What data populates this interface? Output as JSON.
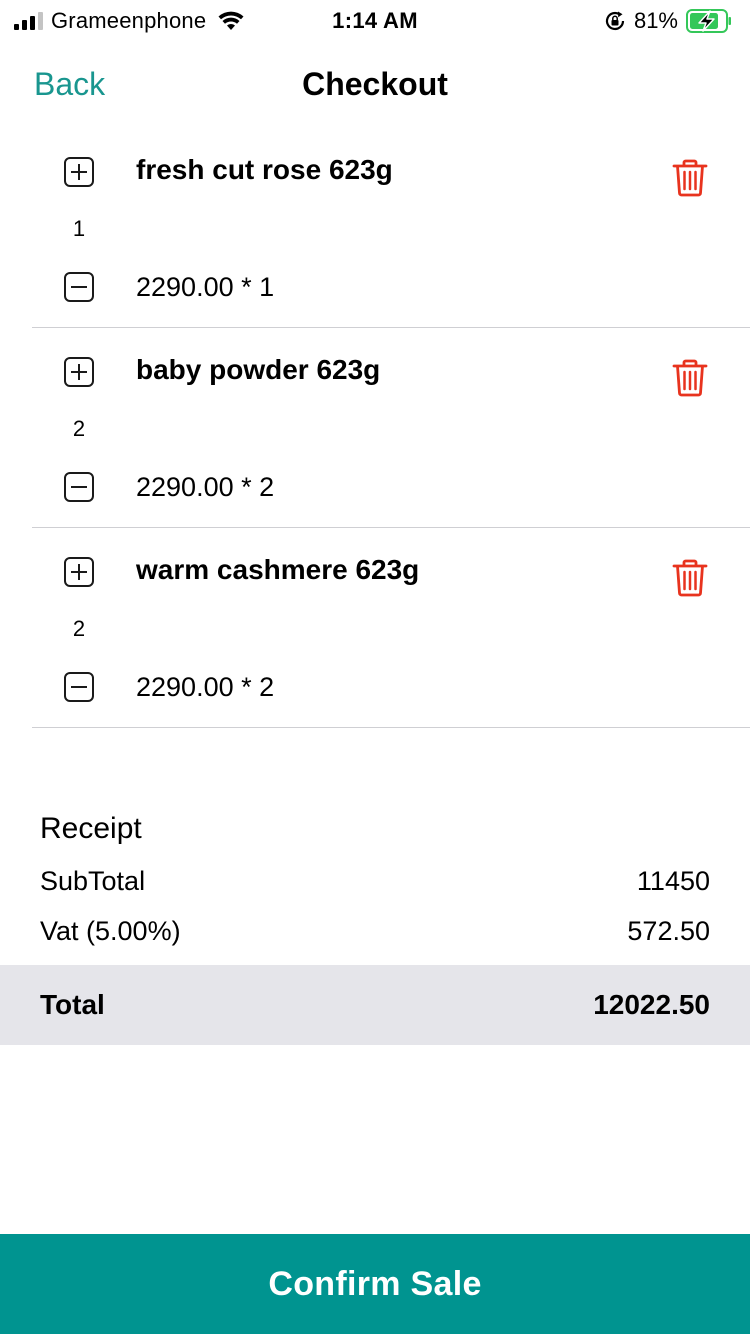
{
  "status_bar": {
    "carrier": "Grameenphone",
    "time": "1:14 AM",
    "battery_percent": "81%",
    "signal_bars": 3,
    "icons": [
      "signal-icon",
      "wifi-icon",
      "orientation-lock-icon",
      "battery-charging-icon"
    ]
  },
  "nav": {
    "back_label": "Back",
    "title": "Checkout"
  },
  "items": [
    {
      "name": "fresh cut rose 623g",
      "quantity": "1",
      "price_line": "2290.00 * 1"
    },
    {
      "name": "baby powder 623g",
      "quantity": "2",
      "price_line": "2290.00 * 2"
    },
    {
      "name": "warm cashmere 623g",
      "quantity": "2",
      "price_line": "2290.00 * 2"
    }
  ],
  "receipt": {
    "title": "Receipt",
    "subtotal_label": "SubTotal",
    "subtotal_value": "11450",
    "vat_label": "Vat (5.00%)",
    "vat_value": "572.50",
    "total_label": "Total",
    "total_value": "12022.50"
  },
  "confirm_label": "Confirm Sale",
  "colors": {
    "accent": "#19968f",
    "confirm_bg": "#009490",
    "trash": "#e8331e",
    "total_bg": "#e5e5ea",
    "battery_fill": "#34c759"
  }
}
